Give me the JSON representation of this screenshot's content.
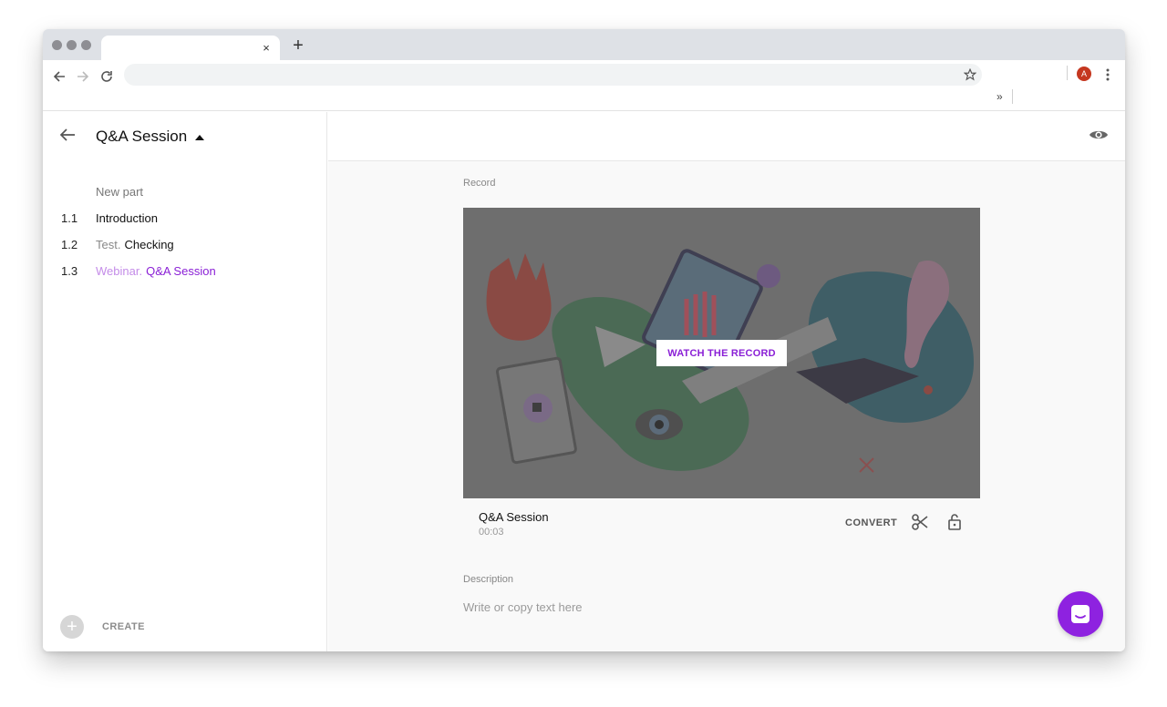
{
  "browser": {
    "tab_close": "×",
    "new_tab": "+",
    "profile_initial": "A",
    "bookmarks_more": "»"
  },
  "sidebar": {
    "title": "Q&A Session",
    "new_part": "New part",
    "items": [
      {
        "num": "1.1",
        "prefix": "",
        "name": "Introduction",
        "active": false
      },
      {
        "num": "1.2",
        "prefix": "Test.",
        "name": "Checking",
        "active": false
      },
      {
        "num": "1.3",
        "prefix": "Webinar.",
        "name": "Q&A Session",
        "active": true
      }
    ],
    "create_label": "CREATE"
  },
  "main": {
    "record_label": "Record",
    "watch_button": "WATCH THE RECORD",
    "record_title": "Q&A Session",
    "record_duration": "00:03",
    "convert_label": "CONVERT",
    "description_label": "Description",
    "description_placeholder": "Write or copy text here"
  },
  "colors": {
    "accent": "#8a1fd6",
    "accent_light": "#c48ce8",
    "chat_button": "#8e22e0",
    "profile": "#c5371f"
  }
}
